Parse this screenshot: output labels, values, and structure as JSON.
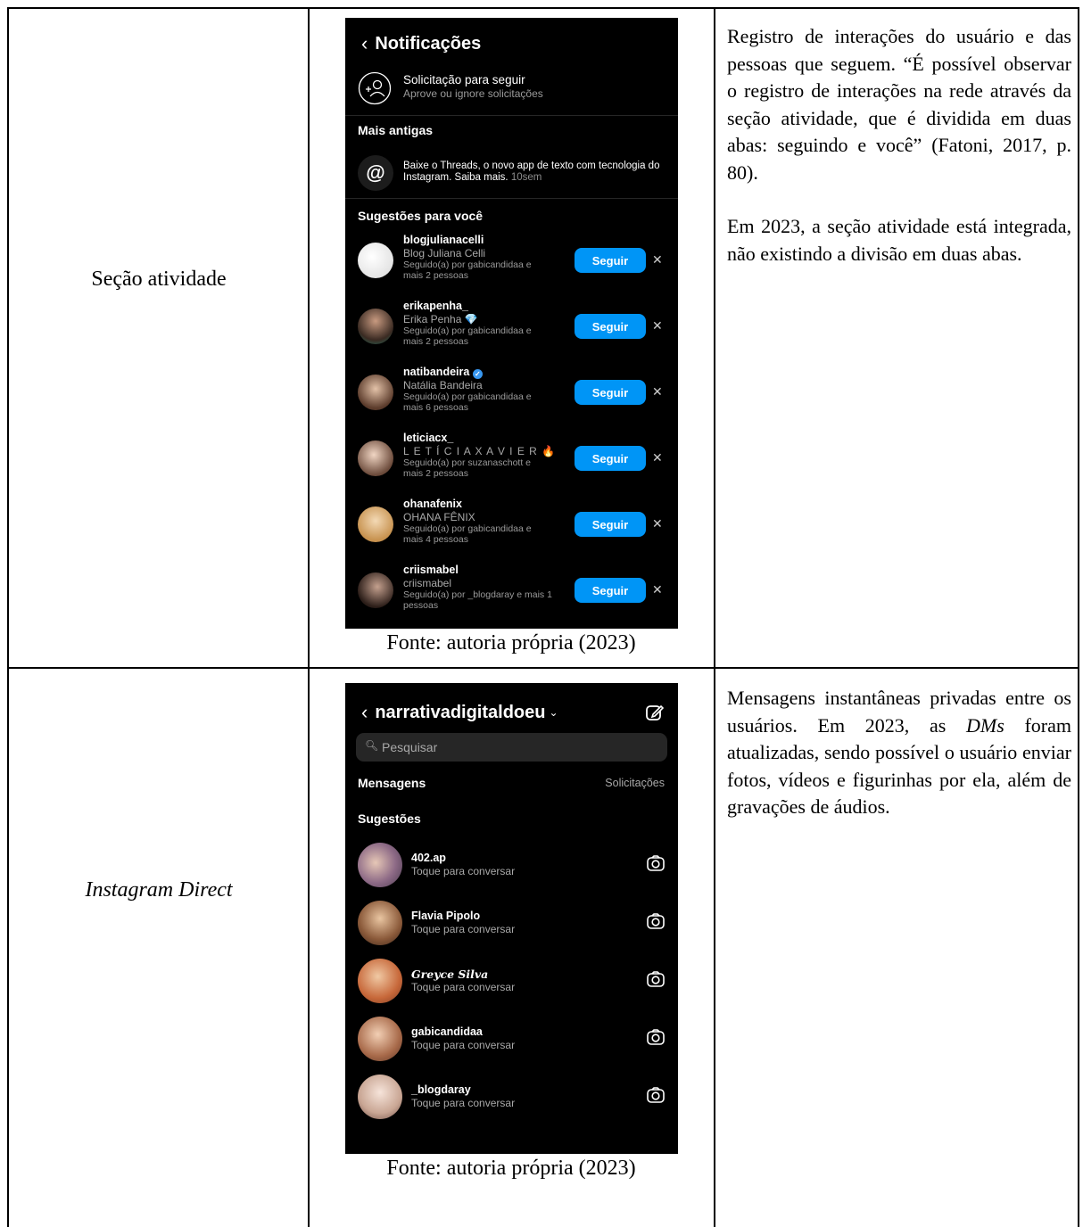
{
  "row1": {
    "label": "Seção atividade",
    "caption": "Fonte: autoria própria (2023)",
    "description": [
      "Registro de interações do usuário e das pessoas que seguem. “É possível observar o registro de interações na rede através da seção atividade, que é dividida em duas abas: seguindo e você” (Fatoni, 2017, p. 80).",
      "Em 2023, a seção atividade está integrada, não existindo a divisão em duas abas."
    ],
    "screen": {
      "title": "Notificações",
      "follow_request_title": "Solicitação para seguir",
      "follow_request_sub": "Aprove ou ignore solicitações",
      "older_section": "Mais antigas",
      "threads_text": "Baixe o Threads, o novo app de texto com tecnologia do Instagram. Saiba mais.",
      "threads_time": "10sem",
      "suggestions_section": "Sugestões para você",
      "follow_button": "Seguir",
      "suggestions": [
        {
          "username": "blogjulianacelli",
          "name": "Blog Juliana Celli",
          "followed": "Seguido(a) por gabicandidaa e mais 2 pessoas"
        },
        {
          "username": "erikapenha_",
          "name": "Erika Penha 💎",
          "followed": "Seguido(a) por gabicandidaa e mais 2 pessoas"
        },
        {
          "username": "natibandeira",
          "name": "Natália Bandeira",
          "followed": "Seguido(a) por gabicandidaa e mais 6 pessoas",
          "verified": true
        },
        {
          "username": "leticiacx_",
          "name": "L E T Í C I A  X A V I E R 🔥",
          "followed": "Seguido(a) por suzanaschott e mais 2 pessoas"
        },
        {
          "username": "ohanafenix",
          "name": "OHANA FÊNIX",
          "followed": "Seguido(a) por gabicandidaa e mais 4 pessoas"
        },
        {
          "username": "criismabel",
          "name": "criismabel",
          "followed": "Seguido(a) por _blogdaray e mais 1 pessoas"
        }
      ]
    }
  },
  "row2": {
    "label": "Instagram Direct",
    "caption": "Fonte: autoria própria (2023)",
    "description_parts": [
      "Mensagens instantâneas privadas entre os usuários. Em 2023, as ",
      "DMs",
      " foram atualizadas, sendo possível o usuário enviar fotos, vídeos e figurinhas por ela, além de gravações de áudios."
    ],
    "screen": {
      "account": "narrativadigitaldoeu",
      "search_placeholder": "Pesquisar",
      "messages_tab": "Mensagens",
      "requests_tab": "Solicitações",
      "suggestions_section": "Sugestões",
      "contacts": [
        {
          "name": "402.ap",
          "sub": "Toque para conversar"
        },
        {
          "name": "Flavia Pipolo",
          "sub": "Toque para conversar"
        },
        {
          "name": "Greyce Silva",
          "sub": "Toque para conversar"
        },
        {
          "name": "gabicandidaa",
          "sub": "Toque para conversar"
        },
        {
          "name": "_blogdaray",
          "sub": "Toque para conversar"
        }
      ]
    }
  },
  "colors": {
    "accent": "#0095f6",
    "phone_bg": "#000000",
    "verified": "#3897f0"
  }
}
